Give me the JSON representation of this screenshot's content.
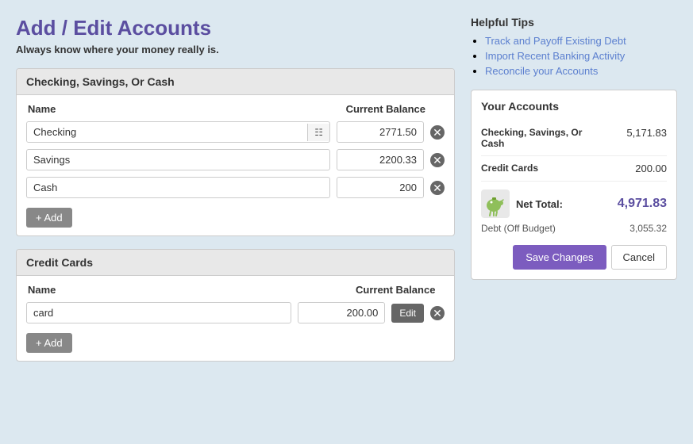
{
  "page": {
    "title": "Add / Edit Accounts",
    "subtitle": "Always know where your money really is."
  },
  "sections": {
    "checking_savings": {
      "header": "Checking, Savings, Or Cash",
      "col_name": "Name",
      "col_balance": "Current Balance",
      "accounts": [
        {
          "name": "Checking",
          "balance": "2771.50",
          "has_icon": true
        },
        {
          "name": "Savings",
          "balance": "2200.33",
          "has_icon": false
        },
        {
          "name": "Cash",
          "balance": "200",
          "has_icon": false
        }
      ],
      "add_label": "+ Add"
    },
    "credit_cards": {
      "header": "Credit Cards",
      "col_name": "Name",
      "col_balance": "Current Balance",
      "accounts": [
        {
          "name": "card",
          "balance": "200.00"
        }
      ],
      "add_label": "+ Add",
      "edit_label": "Edit"
    }
  },
  "helpful_tips": {
    "title": "Helpful Tips",
    "items": [
      {
        "label": "Track and Payoff Existing Debt",
        "href": "#"
      },
      {
        "label": "Import Recent Banking Activity",
        "href": "#"
      },
      {
        "label": "Reconcile your Accounts",
        "href": "#"
      }
    ]
  },
  "your_accounts": {
    "title": "Your Accounts",
    "rows": [
      {
        "label": "Checking, Savings, Or\nCash",
        "value": "5,171.83"
      },
      {
        "label": "Credit Cards",
        "value": "200.00"
      }
    ],
    "net_total_label": "Net Total:",
    "net_total_value": "4,971.83",
    "debt_label": "Debt (Off Budget)",
    "debt_value": "3,055.32",
    "save_label": "Save Changes",
    "cancel_label": "Cancel"
  }
}
